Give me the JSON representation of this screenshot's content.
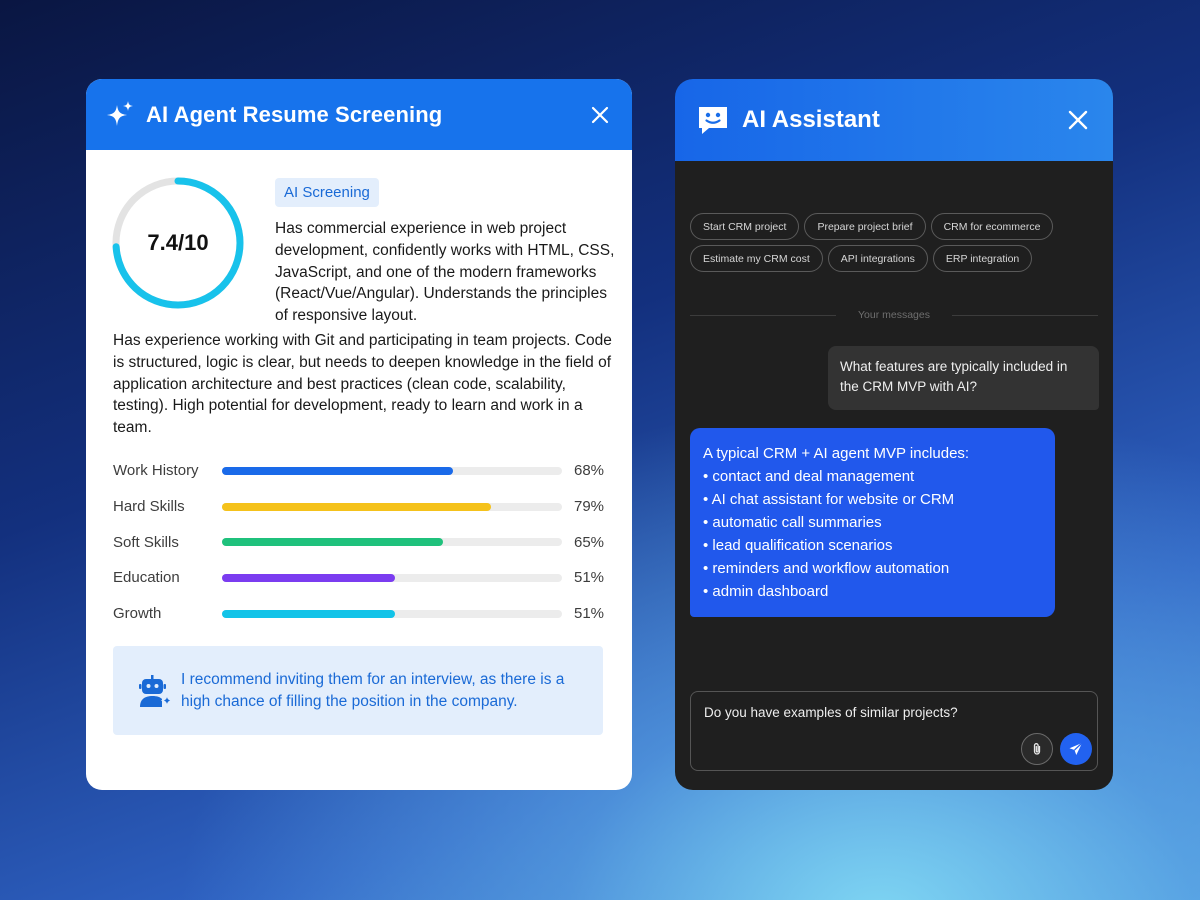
{
  "screening": {
    "title": "AI Agent Resume Screening",
    "score": "7.4/10",
    "score_fraction": 0.74,
    "chip": "AI Screening",
    "summary_part1": "Has commercial experience in web project development, confidently works with HTML, CSS, JavaScript, and one of the modern frameworks (React/Vue/Angular). Understands the principles of responsive layout.",
    "summary_part2": "Has experience working with Git and participating in team projects. Code is structured, logic is clear, but needs to deepen knowledge in the field of application architecture and best practices (clean code, scalability, testing). High potential for development, ready to learn and work in a team.",
    "metrics": [
      {
        "label": "Work History",
        "value": 68,
        "pct": "68%",
        "color": "#1a6ae9"
      },
      {
        "label": "Hard Skills",
        "value": 79,
        "pct": "79%",
        "color": "#f5c21b"
      },
      {
        "label": "Soft Skills",
        "value": 65,
        "pct": "65%",
        "color": "#1fc17c"
      },
      {
        "label": "Education",
        "value": 51,
        "pct": "51%",
        "color": "#7b3cf0"
      },
      {
        "label": "Growth",
        "value": 51,
        "pct": "51%",
        "color": "#12c3e8"
      }
    ],
    "recommendation": "I recommend inviting them for an interview, as there is a high chance of filling the position in the company.",
    "accent_color": "#1773ec",
    "ring_color": "#18c2eb"
  },
  "assistant": {
    "title": "AI Assistant",
    "suggestions_row1": [
      "Start CRM project",
      "Prepare project brief",
      "CRM for ecommerce"
    ],
    "suggestions_row2": [
      "Estimate my CRM cost",
      "API integrations",
      "ERP integration"
    ],
    "divider_label": "Your messages",
    "user_message": "What features are typically included in the CRM MVP with AI?",
    "ai_message_lines": [
      "A typical CRM + AI agent MVP includes:",
      "• contact and deal management",
      "• AI chat assistant for website or CRM",
      "• automatic call summaries",
      "• lead qualification scenarios",
      "• reminders and workflow automation",
      "• admin dashboard"
    ],
    "input_value": "Do you have examples of similar projects?",
    "accent_color": "#2158ec"
  }
}
